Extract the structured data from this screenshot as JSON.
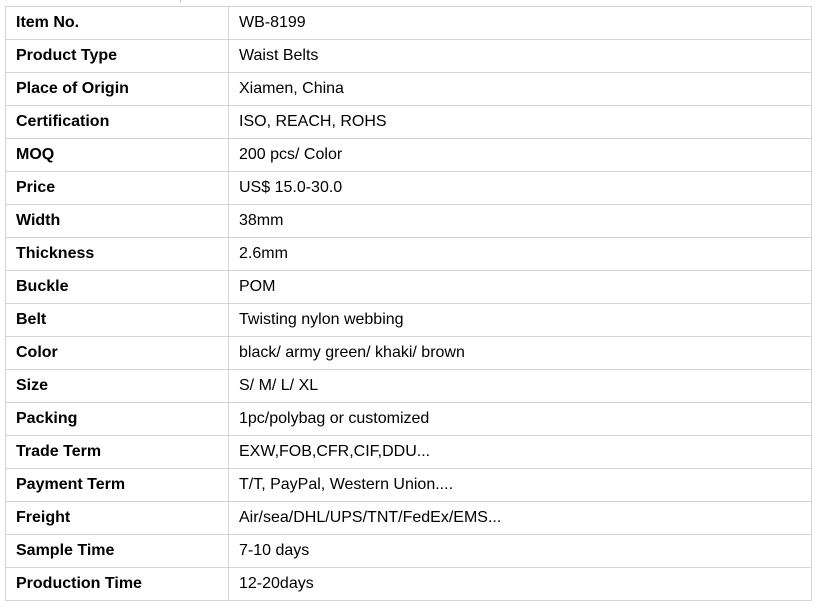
{
  "spec_table": {
    "rows": [
      {
        "label": "Item No.",
        "value": "WB-8199"
      },
      {
        "label": "Product Type",
        "value": "Waist Belts"
      },
      {
        "label": "Place of Origin",
        "value": "Xiamen, China"
      },
      {
        "label": "Certification",
        "value": "ISO, REACH, ROHS"
      },
      {
        "label": "MOQ",
        "value": "200 pcs/ Color"
      },
      {
        "label": "Price",
        "value": "US$ 15.0-30.0"
      },
      {
        "label": "Width",
        "value": "38mm"
      },
      {
        "label": "Thickness",
        "value": "2.6mm"
      },
      {
        "label": "Buckle",
        "value": "POM"
      },
      {
        "label": "Belt",
        "value": "Twisting nylon webbing"
      },
      {
        "label": "Color",
        "value": "black/ army green/ khaki/ brown"
      },
      {
        "label": "Size",
        "value": "S/ M/ L/ XL"
      },
      {
        "label": "Packing",
        "value": "1pc/polybag or customized"
      },
      {
        "label": "Trade Term",
        "value": "EXW,FOB,CFR,CIF,DDU..."
      },
      {
        "label": "Payment Term",
        "value": "T/T, PayPal, Western Union...."
      },
      {
        "label": "Freight",
        "value": "Air/sea/DHL/UPS/TNT/FedEx/EMS..."
      },
      {
        "label": "Sample Time",
        "value": "7-10 days"
      },
      {
        "label": "Production Time",
        "value": "12-20days"
      }
    ]
  }
}
